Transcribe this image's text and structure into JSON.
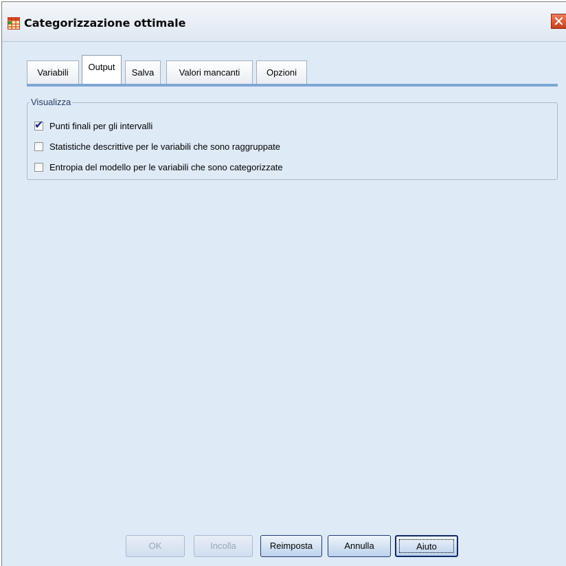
{
  "window": {
    "title": "Categorizzazione ottimale",
    "close_symbol": "✕"
  },
  "tabs": [
    {
      "label": "Variabili",
      "active": false
    },
    {
      "label": "Output",
      "active": true
    },
    {
      "label": "Salva",
      "active": false
    },
    {
      "label": "Valori mancanti",
      "active": false
    },
    {
      "label": "Opzioni",
      "active": false
    }
  ],
  "display_group": {
    "title": "Visualizza",
    "options": [
      {
        "label": "Punti finali per gli intervalli",
        "checked": true
      },
      {
        "label": "Statistiche descrittive per le variabili che sono raggruppate",
        "checked": false
      },
      {
        "label": "Entropia del modello per le variabili che sono categorizzate",
        "checked": false
      }
    ]
  },
  "buttons": {
    "ok": {
      "label": "OK",
      "enabled": false
    },
    "paste": {
      "label": "Incolla",
      "enabled": false
    },
    "reset": {
      "label": "Reimposta",
      "enabled": true
    },
    "cancel": {
      "label": "Annulla",
      "enabled": true
    },
    "help": {
      "label": "Aiuto",
      "enabled": true,
      "focused": true
    }
  },
  "icons": {
    "app": "table-grid-icon",
    "close": "close-icon",
    "check": "checkmark-icon"
  },
  "colors": {
    "dialog_bg": "#dfeaf7",
    "tab_accent": "#7ea6d4",
    "close_red": "#c8401c",
    "check_blue": "#1a2a8f"
  }
}
